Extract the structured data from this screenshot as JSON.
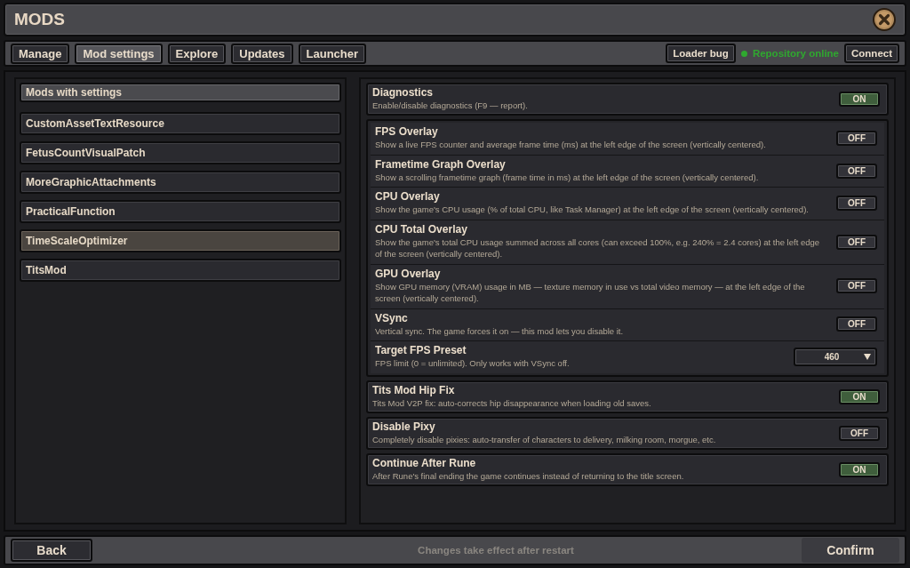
{
  "window": {
    "title": "MODS"
  },
  "tabs": [
    {
      "label": "Manage",
      "selected": false
    },
    {
      "label": "Mod settings",
      "selected": true
    },
    {
      "label": "Explore",
      "selected": false
    },
    {
      "label": "Updates",
      "selected": false
    },
    {
      "label": "Launcher",
      "selected": false
    }
  ],
  "toolbar": {
    "loader_bug_button": "Loader bug",
    "repository_status": {
      "text": "Repository online",
      "color": "#2fa82f"
    },
    "connect_button": "Connect"
  },
  "mod_list": {
    "header": "Mods with settings",
    "items": [
      {
        "label": "CustomAssetTextResource",
        "selected": false
      },
      {
        "label": "FetusCountVisualPatch",
        "selected": false
      },
      {
        "label": "MoreGraphicAttachments",
        "selected": false
      },
      {
        "label": "PracticalFunction",
        "selected": false
      },
      {
        "label": "TimeScaleOptimizer",
        "selected": true
      },
      {
        "label": "TitsMod",
        "selected": false
      }
    ]
  },
  "settings": [
    {
      "kind": "toggle",
      "title": "Diagnostics",
      "description": "Enable/disable diagnostics (F9 — report).",
      "on": true,
      "switch_label": "ON"
    },
    {
      "kind": "group",
      "children": [
        {
          "kind": "toggle",
          "title": "FPS Overlay",
          "description": "Show a live FPS counter and average frame time (ms) at the left edge of the screen (vertically centered).",
          "on": false,
          "switch_label": "OFF"
        },
        {
          "kind": "toggle",
          "title": "Frametime Graph Overlay",
          "description": "Show a scrolling frametime graph (frame time in ms) at the left edge of the screen (vertically centered).",
          "on": false,
          "switch_label": "OFF"
        },
        {
          "kind": "toggle",
          "title": "CPU Overlay",
          "description": "Show the game's CPU usage (% of total CPU, like Task Manager) at the left edge of the screen (vertically centered).",
          "on": false,
          "switch_label": "OFF"
        },
        {
          "kind": "toggle",
          "title": "CPU Total Overlay",
          "description": "Show the game's total CPU usage summed across all cores (can exceed 100%, e.g. 240% = 2.4 cores) at the left edge of the screen (vertically centered).",
          "on": false,
          "switch_label": "OFF"
        },
        {
          "kind": "toggle",
          "title": "GPU Overlay",
          "description": "Show GPU memory (VRAM) usage in MB — texture memory in use vs total video memory — at the left edge of the screen (vertically centered).",
          "on": false,
          "switch_label": "OFF"
        },
        {
          "kind": "toggle",
          "title": "VSync",
          "description": "Vertical sync. The game forces it on — this mod lets you disable it.",
          "on": false,
          "switch_label": "OFF"
        },
        {
          "kind": "dropdown",
          "title": "Target FPS Preset",
          "description": "FPS limit (0 = unlimited). Only works with VSync off.",
          "value": "460"
        }
      ]
    },
    {
      "kind": "toggle",
      "title": "Tits Mod Hip Fix",
      "description": "Tits Mod V2P fix: auto-corrects hip disappearance when loading old saves.",
      "on": true,
      "switch_label": "ON"
    },
    {
      "kind": "toggle",
      "title": "Disable Pixy",
      "description": "Completely disable pixies: auto-transfer of characters to delivery, milking room, morgue, etc.",
      "on": false,
      "switch_label": "OFF"
    },
    {
      "kind": "toggle",
      "title": "Continue After Rune",
      "description": "After Rune's final ending the game continues instead of returning to the title screen.",
      "on": true,
      "switch_label": "ON"
    }
  ],
  "footer": {
    "back_button": "Back",
    "note": "Changes take effect after restart",
    "confirm_button": "Confirm"
  }
}
